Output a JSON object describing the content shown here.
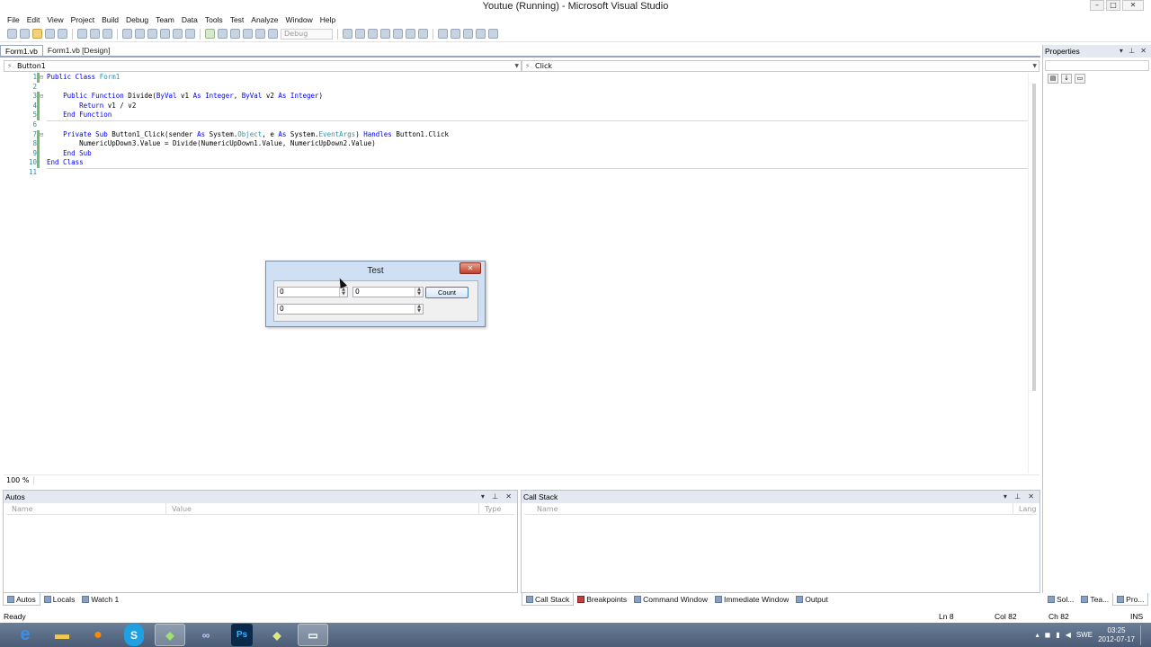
{
  "window": {
    "title": "Youtue (Running) - Microsoft Visual Studio"
  },
  "menu": [
    "File",
    "Edit",
    "View",
    "Project",
    "Build",
    "Debug",
    "Team",
    "Data",
    "Tools",
    "Test",
    "Analyze",
    "Window",
    "Help"
  ],
  "toolbar": {
    "config": "Debug"
  },
  "doc_tabs": [
    {
      "label": "Form1.vb",
      "active": true
    },
    {
      "label": "Form1.vb [Design]",
      "active": false
    }
  ],
  "nav": {
    "object": "Button1",
    "event": "Click"
  },
  "editor": {
    "line_numbers": [
      "1",
      "2",
      "3",
      "4",
      "5",
      "6",
      "7",
      "8",
      "9",
      "10",
      "11"
    ],
    "zoom": "100 %"
  },
  "properties": {
    "title": "Properties"
  },
  "autos": {
    "title": "Autos",
    "columns": [
      "Name",
      "Value",
      "Type"
    ]
  },
  "callstack": {
    "title": "Call Stack",
    "columns": [
      "Name",
      "Lang"
    ]
  },
  "bottom_tabs_left": [
    "Autos",
    "Locals",
    "Watch 1"
  ],
  "bottom_tabs_right": [
    "Call Stack",
    "Breakpoints",
    "Command Window",
    "Immediate Window",
    "Output"
  ],
  "right_tabs": [
    "Sol...",
    "Tea...",
    "Pro..."
  ],
  "status": {
    "ready": "Ready",
    "ln": "Ln 8",
    "col": "Col 82",
    "ch": "Ch 82",
    "ins": "INS"
  },
  "taskbar": {
    "lang": "SWE",
    "time": "03:25",
    "date": "2012-07-17"
  },
  "form": {
    "title": "Test",
    "nud1": "0",
    "nud2": "0",
    "nud3": "0",
    "button": "Count"
  }
}
